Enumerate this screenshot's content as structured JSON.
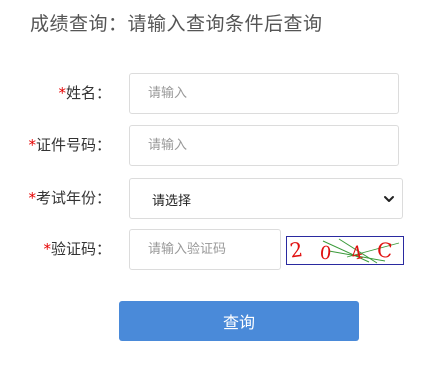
{
  "header": {
    "title": "成绩查询：请输入查询条件后查询"
  },
  "form": {
    "required_mark": "*",
    "name": {
      "label": "姓名：",
      "placeholder": "请输入",
      "value": ""
    },
    "id_number": {
      "label": "证件号码：",
      "placeholder": "请输入",
      "value": ""
    },
    "exam_year": {
      "label": "考试年份：",
      "selected": "请选择"
    },
    "captcha": {
      "label": "验证码：",
      "placeholder": "请输入验证码",
      "value": "",
      "image_text": "2 0 4 C",
      "image_chars": [
        "2",
        "0",
        "4",
        "C"
      ]
    },
    "submit_label": "查询"
  },
  "colors": {
    "required": "#e60000",
    "button": "#4a8ad9",
    "captcha_text": "#e01010",
    "captcha_noise": "#3a9a3a",
    "captcha_border": "#2a2aa0"
  }
}
